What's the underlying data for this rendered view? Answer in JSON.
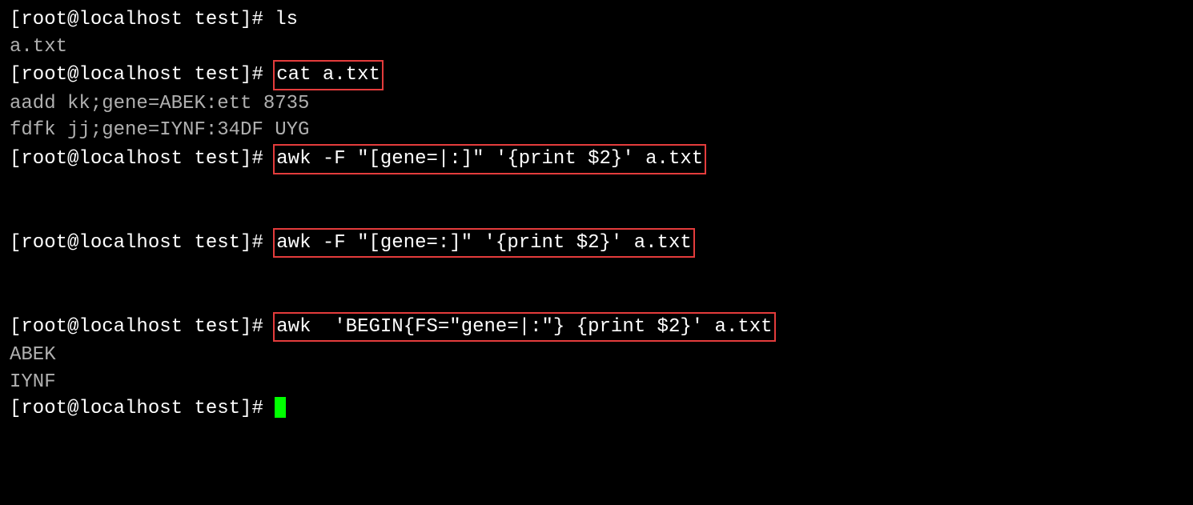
{
  "prompt": "[root@localhost test]# ",
  "lines": {
    "cmd1": "ls",
    "out1": "a.txt",
    "cmd2": "cat a.txt",
    "out2a": "aadd kk;gene=ABEK:ett 8735",
    "out2b": "fdfk jj;gene=IYNF:34DF UYG",
    "cmd3": "awk -F \"[gene=|:]\" '{print $2}' a.txt",
    "out3a": "",
    "out3b": "",
    "cmd4": "awk -F \"[gene=:]\" '{print $2}' a.txt",
    "out4a": "",
    "out4b": "",
    "cmd5": "awk  'BEGIN{FS=\"gene=|:\"} {print $2}' a.txt",
    "out5a": "ABEK",
    "out5b": "IYNF"
  }
}
